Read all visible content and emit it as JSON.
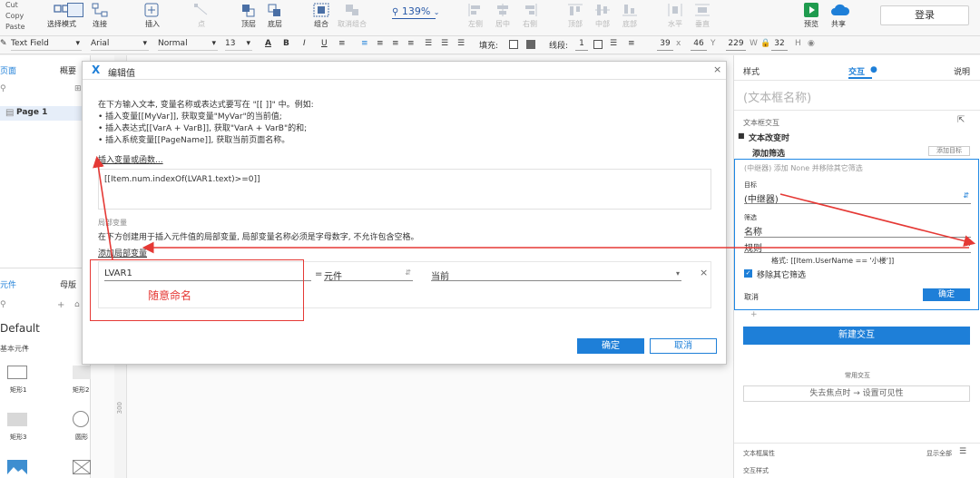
{
  "toolbar": {
    "clipboard": [
      "Cut",
      "Copy",
      "Paste"
    ],
    "buttons": [
      {
        "label": "选择模式",
        "enabled": true
      },
      {
        "label": "连接",
        "enabled": true
      },
      {
        "label": "插入",
        "enabled": true
      },
      {
        "label": "点",
        "enabled": false
      },
      {
        "label": "顶层",
        "enabled": true
      },
      {
        "label": "底层",
        "enabled": true
      },
      {
        "label": "组合",
        "enabled": true
      },
      {
        "label": "取消组合",
        "enabled": false
      },
      {
        "label": "左侧",
        "enabled": false
      },
      {
        "label": "居中",
        "enabled": false
      },
      {
        "label": "右侧",
        "enabled": false
      },
      {
        "label": "顶部",
        "enabled": false
      },
      {
        "label": "中部",
        "enabled": false
      },
      {
        "label": "底部",
        "enabled": false
      },
      {
        "label": "水平",
        "enabled": false
      },
      {
        "label": "垂直",
        "enabled": false
      },
      {
        "label": "预览",
        "enabled": true
      },
      {
        "label": "共享",
        "enabled": true
      }
    ],
    "zoom": "139%",
    "login": "登录"
  },
  "format_bar": {
    "style": "Text Field",
    "font": "Arial",
    "weight": "Normal",
    "size": "13",
    "fill_label": "填充:",
    "line_label": "线段:",
    "line_value": "1",
    "x_value": "39",
    "x_label": "x",
    "w_value": "46",
    "w_label": "Y",
    "y_value": "229",
    "y_label": "W",
    "h_value": "32",
    "h_label": "H"
  },
  "left_panel": {
    "tabs": [
      "页面",
      "概要"
    ],
    "page_item": "Page 1",
    "lib_tabs": [
      "元件",
      "母版"
    ],
    "library": "Default",
    "lib_section": "基本元件",
    "widgets": [
      "矩形1",
      "矩形2",
      "矩形3",
      "圆形"
    ]
  },
  "canvas": {
    "ruler_mark": "300"
  },
  "dialog": {
    "title": "编辑值",
    "intro": [
      "在下方输入文本, 变量名称或表达式要写在 \"[[ ]]\" 中。例如:",
      "• 插入变量[[MyVar]], 获取变量\"MyVar\"的当前值;",
      "• 插入表达式[[VarA + VarB]], 获取\"VarA + VarB\"的和;",
      "• 插入系统变量[[PageName]], 获取当前页面名称。"
    ],
    "insert_link": "插入变量或函数...",
    "expression": "[[Item.num.indexOf(LVAR1.text)>=0]]",
    "local_header": "局部变量",
    "local_desc": "在下方创建用于插入元件值的局部变量, 局部变量名称必须是字母数字, 不允许包含空格。",
    "add_local_link": "添加局部变量",
    "var_name": "LVAR1",
    "equals": "=",
    "var_type": "元件",
    "var_target": "当前",
    "annotation": "随意命名",
    "ok": "确定",
    "cancel": "取消"
  },
  "right_panel": {
    "tabs": [
      "样式",
      "交互",
      "说明"
    ],
    "active_tab": "交互",
    "name_placeholder": "(文本框名称)",
    "section_title": "文本框交互",
    "event": "文本改变时",
    "action": "添加筛选",
    "add_target": "添加目标",
    "summary": "(中继器) 添加 None 并移除其它筛选",
    "target_label": "目标",
    "target_value": "(中继器)",
    "filter_label": "筛选",
    "name_label": "名称",
    "rule_label": "规则",
    "fx": "fx",
    "format_hint": "格式: [[Item.UserName == '小楼']]",
    "remove_other": "移除其它筛选",
    "cancel": "取消",
    "ok": "确定",
    "new_interaction": "新建交互",
    "common_label": "常用交互",
    "common_item": "失去焦点时 → 设置可见性",
    "props_title": "文本框属性",
    "show_all": "显示全部",
    "interaction_style": "交互样式"
  },
  "colors": {
    "accent": "#1e7fd8",
    "annotation_red": "#e53935",
    "highlight_blue": "#1e88e5"
  }
}
